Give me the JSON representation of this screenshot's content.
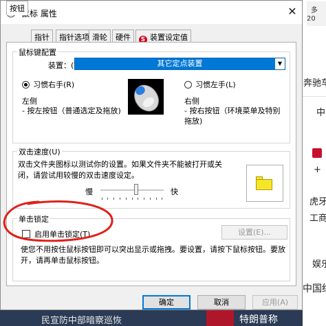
{
  "window": {
    "title": "鼠标 属性",
    "close_label": "✕"
  },
  "tabs": [
    {
      "label": "按钮",
      "active": true
    },
    {
      "label": "指针",
      "active": false
    },
    {
      "label": "指针选项",
      "active": false
    },
    {
      "label": "滑轮",
      "active": false
    },
    {
      "label": "硬件",
      "active": false
    },
    {
      "label": "装置设定值",
      "active": false,
      "icon_text": "S"
    }
  ],
  "button_config": {
    "group_label": "鼠标键配置",
    "device_label": "装置：(V)",
    "device_value": "其它定点装置",
    "right_hand_radio": "习惯右手(R)",
    "left_hand_radio": "习惯左手(L)",
    "selected": "right",
    "left_side_title": "左侧",
    "left_side_desc": "- 按左按钮（普通选定及拖放)",
    "right_side_title": "右侧",
    "right_side_desc": "- 按右按钮（环境菜单及特别拖放)"
  },
  "double_click": {
    "group_label": "双击速度(U)",
    "description": "双击文件夹图标以测试你的设置。如果文件夹不能被打开或关闭，请尝试用较慢的双击速度设定。",
    "slow_label": "慢",
    "fast_label": "快",
    "speed_level": 0.57
  },
  "click_lock": {
    "group_label": "单击锁定",
    "checkbox_label": "启用单击锁定(T)",
    "checked": false,
    "settings_button": "设置(E)...",
    "description": "使您不用按住鼠标按钮即可以突出显示或拖拽。要设置，请按下鼠标按钮。要放开，请再单击鼠标按钮。"
  },
  "buttons": {
    "ok": "确定",
    "cancel": "取消",
    "apply": "应用(A)"
  },
  "background": {
    "items": [
      "多",
      "20",
      "奔驰车",
      "中",
      "+",
      "虎牙",
      "工商",
      "娱乐",
      "中国红",
      "特朗普称"
    ],
    "bottom_left_text": "民宣防中部暗察巡恢"
  },
  "colors": {
    "selection_blue": "#0078d7",
    "annotation_red": "#e0201a",
    "folder_yellow": "#f5e62a"
  }
}
